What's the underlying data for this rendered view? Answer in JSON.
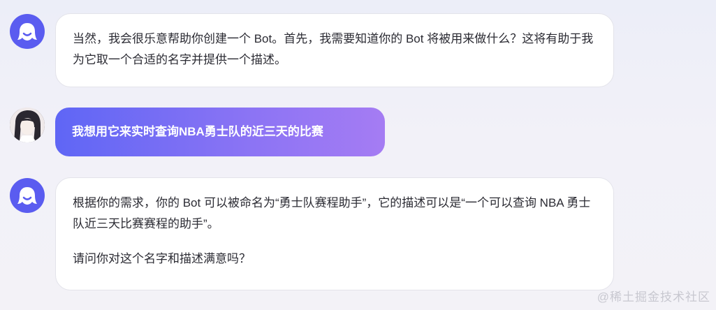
{
  "messages": [
    {
      "role": "bot",
      "avatar_icon": "bot-ghost-icon",
      "paragraphs": [
        "当然，我会很乐意帮助你创建一个 Bot。首先，我需要知道你的 Bot 将被用来做什么？这将有助于我为它取一个合适的名字并提供一个描述。"
      ]
    },
    {
      "role": "user",
      "avatar_icon": "user-avatar-photo",
      "text": "我想用它来实时查询NBA勇士队的近三天的比赛"
    },
    {
      "role": "bot",
      "avatar_icon": "bot-ghost-icon",
      "paragraphs": [
        "根据你的需求，你的 Bot 可以被命名为“勇士队赛程助手”，它的描述可以是“一个可以查询 NBA 勇士队近三天比赛赛程的助手”。",
        "请问你对这个名字和描述满意吗？"
      ]
    }
  ],
  "watermark": "@稀土掘金技术社区",
  "colors": {
    "bot_avatar": "#5a5cf0",
    "user_bubble_start": "#5f66f5",
    "user_bubble_end": "#a57cf3"
  }
}
